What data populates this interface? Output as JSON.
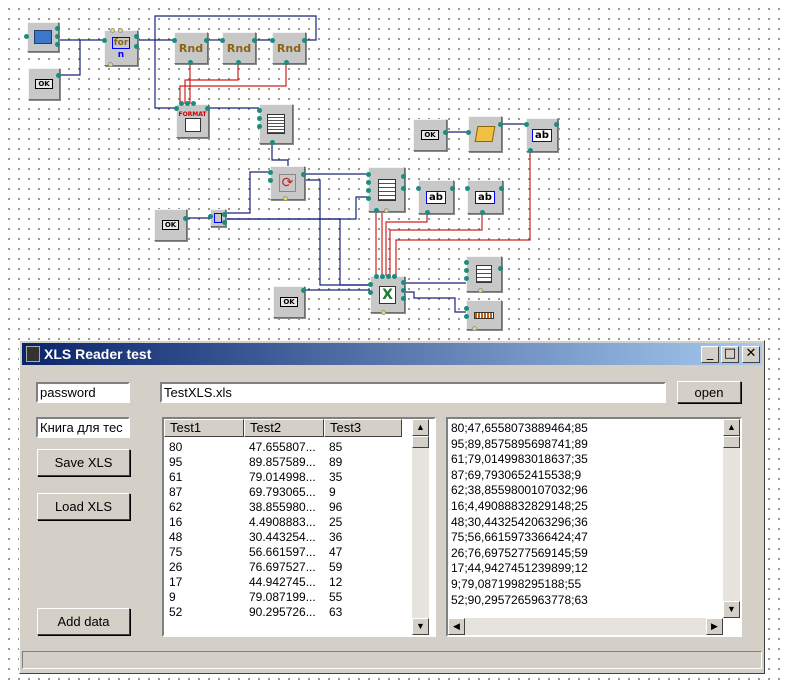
{
  "scheme": {
    "rnd_label": "Rnd",
    "ok_label": "OK",
    "for_label": "for",
    "for_sub": "n",
    "format_label": "FORMAT",
    "ab_label": "ab"
  },
  "window": {
    "title": "XLS Reader test",
    "min_glyph": "_",
    "max_glyph": "□",
    "close_glyph": "✕"
  },
  "form": {
    "password_value": "password",
    "sheet_value": "Книга для тес",
    "file_value": "TestXLS.xls",
    "open_label": "open",
    "save_label": "Save XLS",
    "load_label": "Load XLS",
    "add_label": "Add data"
  },
  "grid": {
    "columns": [
      "Test1",
      "Test2",
      "Test3"
    ],
    "rows": [
      [
        "80",
        "47.655807...",
        "85"
      ],
      [
        "95",
        "89.857589...",
        "89"
      ],
      [
        "61",
        "79.014998...",
        "35"
      ],
      [
        "87",
        "69.793065...",
        "9"
      ],
      [
        "62",
        "38.855980...",
        "96"
      ],
      [
        "16",
        "4.4908883...",
        "25"
      ],
      [
        "48",
        "30.443254...",
        "36"
      ],
      [
        "75",
        "56.661597...",
        "47"
      ],
      [
        "26",
        "76.697527...",
        "59"
      ],
      [
        "17",
        "44.942745...",
        "12"
      ],
      [
        "9",
        "79.087199...",
        "55"
      ],
      [
        "52",
        "90.295726...",
        "63"
      ]
    ]
  },
  "memo": {
    "lines": [
      "80;47,6558073889464;85",
      "95;89,8575895698741;89",
      "61;79,0149983018637;35",
      "87;69,7930652415538;9",
      "62;38,8559800107032;96",
      "16;4,49088832829148;25",
      "48;30,4432542063296;36",
      "75;56,6615973366424;47",
      "26;76,6975277569145;59",
      "17;44,9427451239899;12",
      "9;79,0871998295188;55",
      "52;90,2957265963778;63"
    ]
  },
  "colors": {
    "wire_blue": "#1a237e",
    "wire_red": "#d22020",
    "pin": "#1c8c7c",
    "title_start": "#0a246a",
    "title_end": "#a6caf0"
  }
}
